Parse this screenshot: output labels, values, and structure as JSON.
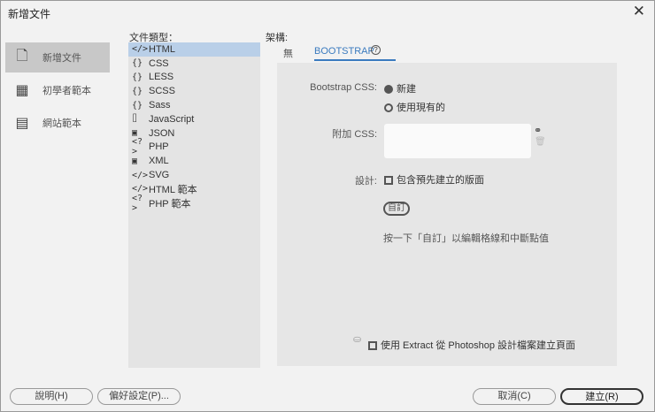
{
  "title": "新增文件",
  "nav": [
    {
      "label": "新增文件",
      "icon": "document-icon"
    },
    {
      "label": "初學者範本",
      "icon": "starter-template-icon"
    },
    {
      "label": "網站範本",
      "icon": "site-template-icon"
    }
  ],
  "file_type_label": "文件類型：",
  "file_types": [
    {
      "glyph": "</>",
      "label": "HTML"
    },
    {
      "glyph": "{}",
      "label": "CSS"
    },
    {
      "glyph": "{}",
      "label": "LESS"
    },
    {
      "glyph": "{}",
      "label": "SCSS"
    },
    {
      "glyph": "{}",
      "label": "Sass"
    },
    {
      "glyph": "⌷",
      "label": "JavaScript"
    },
    {
      "glyph": "▣",
      "label": "JSON"
    },
    {
      "glyph": "<?>",
      "label": "PHP"
    },
    {
      "glyph": "▣",
      "label": "XML"
    },
    {
      "glyph": "</>",
      "label": "SVG"
    },
    {
      "glyph": "</>",
      "label": "HTML 範本"
    },
    {
      "glyph": "<?>",
      "label": "PHP 範本"
    }
  ],
  "framework_label": "架構:",
  "tabs": {
    "none": "無",
    "bootstrap": "BOOTSTRAP",
    "help": "?"
  },
  "bootstrap": {
    "css_label": "Bootstrap CSS:",
    "opt_new": "新建",
    "opt_existing": "使用現有的",
    "attach_label": "附加 CSS:",
    "design_label": "設計:",
    "include_prebuilt": "包含預先建立的版面",
    "customize": "自訂",
    "hint": "按一下「自訂」以編輯格線和中斷點值",
    "extract": "使用 Extract 從 Photoshop 設計檔案建立頁面"
  },
  "buttons": {
    "help": "說明(H)",
    "prefs": "偏好設定(P)...",
    "cancel": "取消(C)",
    "create": "建立(R)"
  }
}
